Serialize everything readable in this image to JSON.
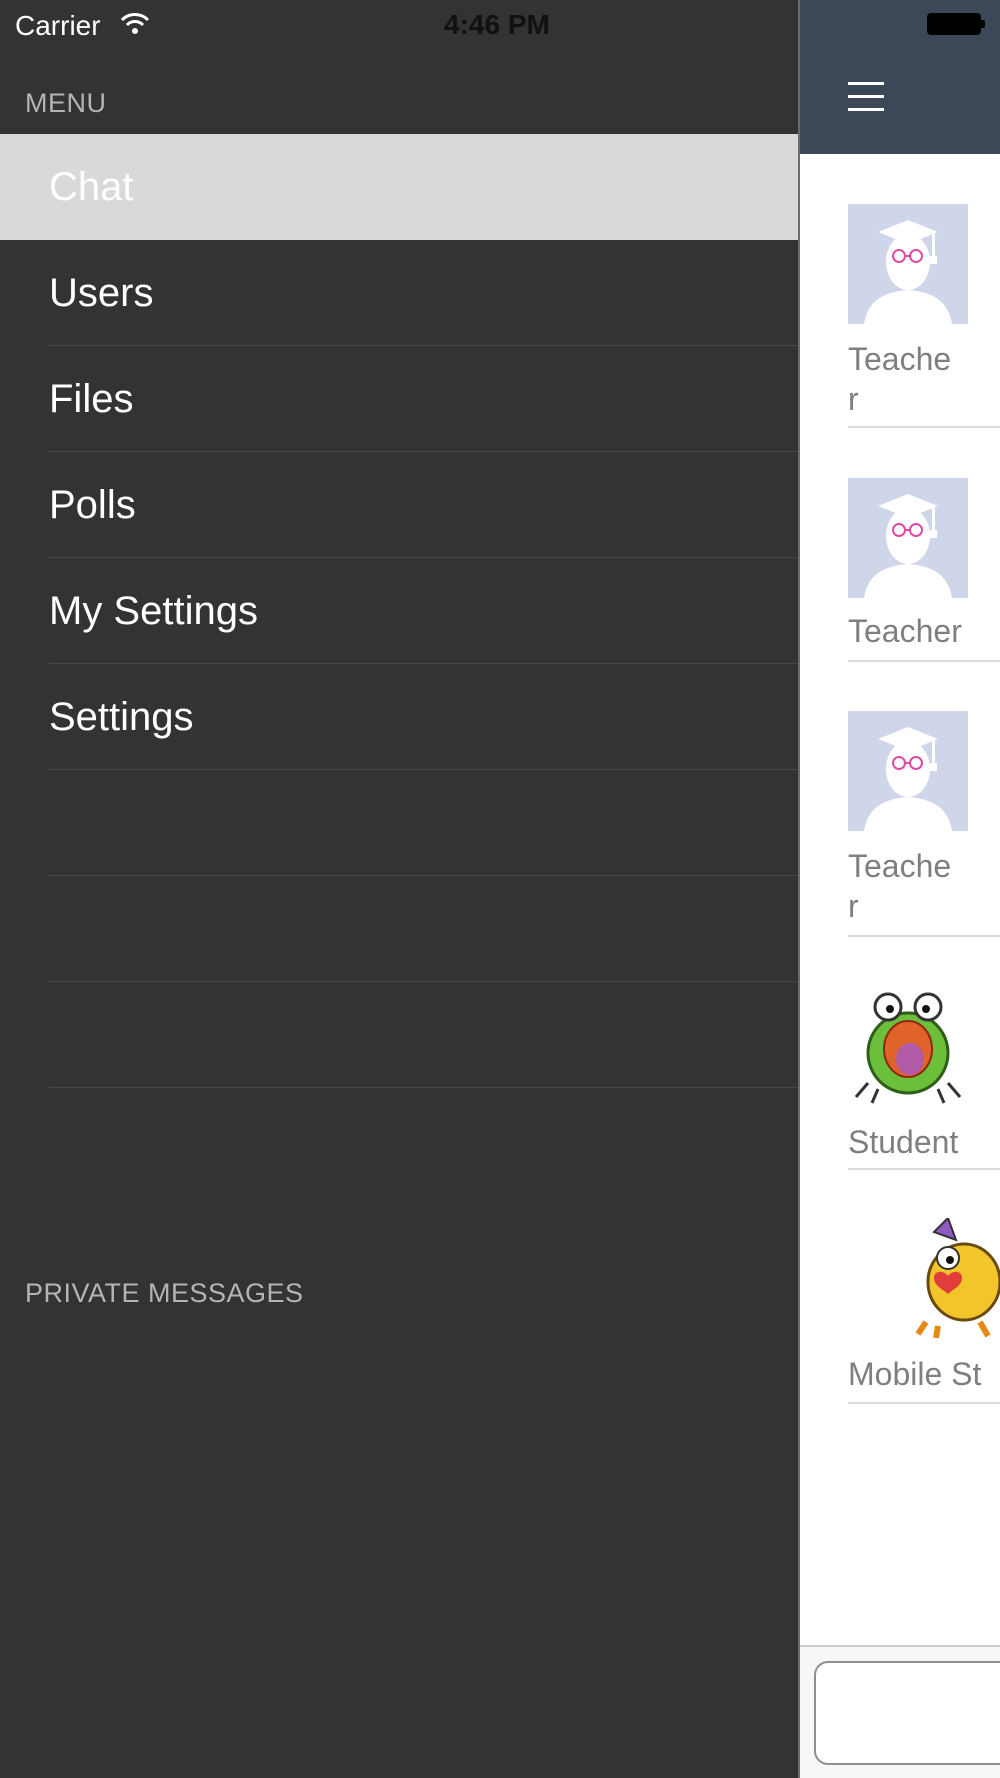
{
  "status_bar": {
    "carrier": "Carrier",
    "time": "4:46 PM"
  },
  "drawer": {
    "menu_header": "MENU",
    "items": [
      {
        "label": "Chat",
        "active": true
      },
      {
        "label": "Users"
      },
      {
        "label": "Files"
      },
      {
        "label": "Polls"
      },
      {
        "label": "My Settings"
      },
      {
        "label": "Settings"
      },
      {
        "label": ""
      },
      {
        "label": ""
      },
      {
        "label": ""
      }
    ],
    "private_messages_header": "PRIVATE MESSAGES"
  },
  "main": {
    "menu_icon": "hamburger-icon",
    "users": [
      {
        "name_line1": "Teache",
        "name_line2": "r",
        "avatar": "teacher-avatar"
      },
      {
        "name_line1": "Teacher",
        "name_line2": "",
        "avatar": "teacher-avatar"
      },
      {
        "name_line1": "Teache",
        "name_line2": "r",
        "avatar": "teacher-avatar"
      },
      {
        "name_line1": "Student",
        "name_line2": "",
        "avatar": "green-monster-avatar"
      },
      {
        "name_line1": "Mobile St",
        "name_line2": "",
        "avatar": "yellow-monster-avatar"
      }
    ],
    "message_input_placeholder": ""
  },
  "colors": {
    "drawer_bg": "#333333",
    "active_item_bg": "#d9d9d9",
    "navbar_bg": "#3c4858",
    "avatar_bg": "#d0d6ea"
  }
}
